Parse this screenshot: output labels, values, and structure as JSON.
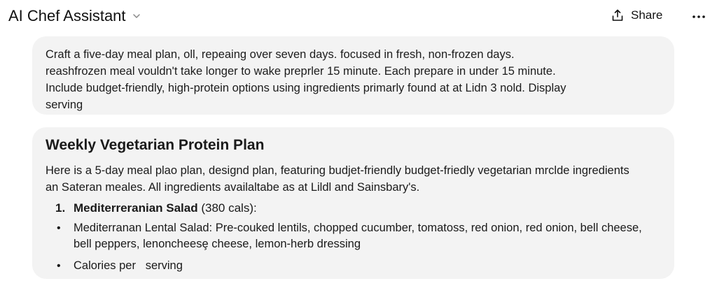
{
  "header": {
    "title": "AI Chef Assistant",
    "share_label": "Share",
    "icons": {
      "title_dropdown": "chevron-down-icon",
      "share": "share-icon",
      "more": "more-horizontal-icon"
    }
  },
  "prompt": {
    "lines": [
      "Craft a five-day meal plan, oll, repeaing over seven days. focused in fresh, non-frozen days.",
      "reashfrozen meal vouldn't take longer to wake preprler 15 minute. Each prepare in under 15 minute.",
      "Include budget-friendly, high-protein options using ingredients primarly found at at Lidn 3 nold. Display",
      "serving"
    ]
  },
  "response": {
    "heading": "Weekly Vegetarian Protein Plan",
    "intro_lines": [
      "Here is a 5-day meal plao plan, designd plan, featuring budjet-friendly budget-friedly vegetarian mrclde ingredients",
      "an Sateran meales. All ingredients availaltabe as at Lildl and Sainsbary's."
    ],
    "item": {
      "number": "1.",
      "name": "Mediterreranian Salad",
      "cals": " (380 cals):"
    },
    "bullets": [
      {
        "line1": "Mediterranan Lental Salad: Pre-couked lentils, chopped cucumber, tomatoss, red onion, red onion, bell cheese,",
        "line2": "bell peppers, lenoncheesȩ cheese, lemon-herb dressing"
      },
      {
        "line1": "Calories per   serving"
      }
    ]
  },
  "colors": {
    "card_bg": "#f3f3f3",
    "text": "#1a1a1a"
  }
}
